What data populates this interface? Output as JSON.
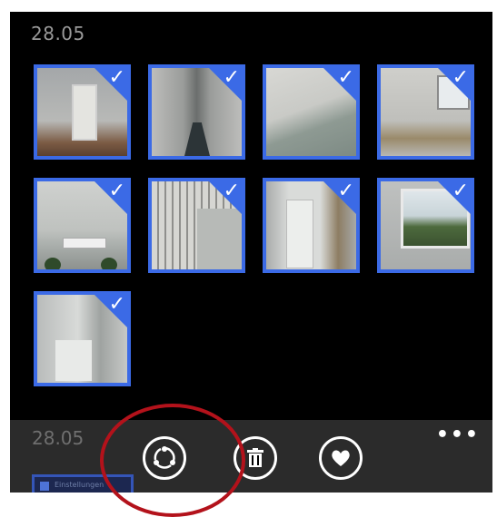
{
  "top_section": {
    "date_label": "28.05"
  },
  "selection": {
    "check_glyph": "✓"
  },
  "app_bar": {
    "peek_date_label": "28.05",
    "peek_thumb_text": "Einstellungen",
    "more_glyph": "•••",
    "buttons": [
      {
        "name": "share-icon"
      },
      {
        "name": "delete-icon"
      },
      {
        "name": "favorite-icon"
      }
    ]
  },
  "colors": {
    "accent": "#3b6ae6",
    "annotation": "#b3121b",
    "appbar": "#2b2b2b"
  }
}
